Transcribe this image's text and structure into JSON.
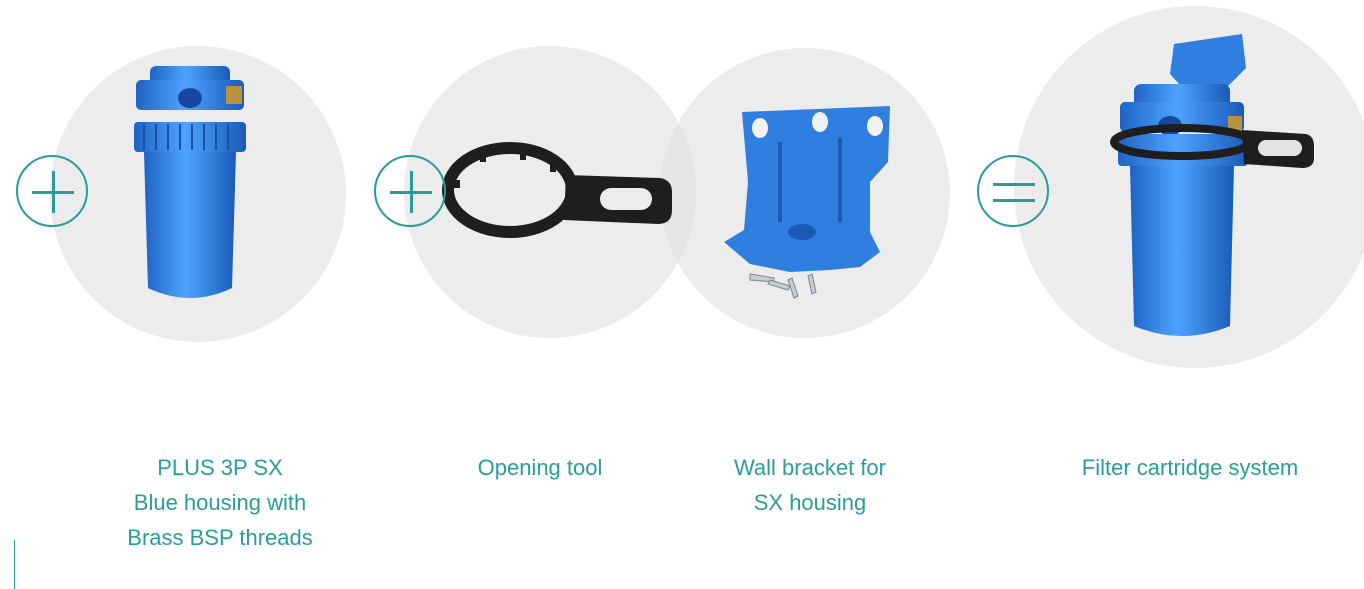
{
  "products": [
    {
      "name": "PLUS 3P SX\nBlue housing with\nBrass BSP threads",
      "image": "blue-filter-housing"
    },
    {
      "name": "Opening tool",
      "image": "opening-tool-wrench"
    },
    {
      "name": "Wall bracket for\nSX housing",
      "image": "wall-bracket-with-screws"
    },
    {
      "name": "Filter cartridge system",
      "image": "assembled-filter-system"
    }
  ],
  "operators": [
    "plus-icon",
    "plus-icon",
    "equals-icon"
  ],
  "colors": {
    "accent": "#2a9d9a",
    "circle": "#e8e8e8",
    "housing_blue": "#2f86e0",
    "tool_black": "#1e1e1e"
  }
}
